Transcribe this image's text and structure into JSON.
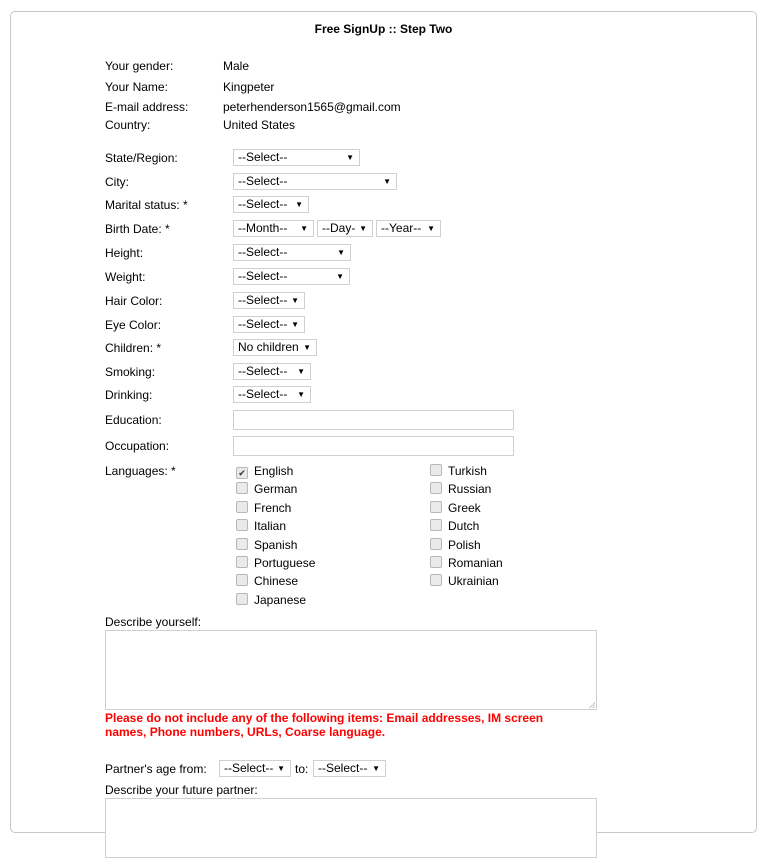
{
  "header": {
    "title": "Free SignUp :: Step Two"
  },
  "info": [
    {
      "label": "Your gender:",
      "value": "Male"
    },
    {
      "label": "Your Name:",
      "value": "Kingpeter"
    },
    {
      "label": "E-mail address:",
      "value": "peterhenderson1565@gmail.com"
    },
    {
      "label": "Country:",
      "value": "United States"
    }
  ],
  "fields": {
    "state": {
      "label": "State/Region:",
      "value": "--Select--"
    },
    "city": {
      "label": "City:",
      "value": "--Select--"
    },
    "marital": {
      "label": "Marital status: *",
      "value": "--Select--"
    },
    "birth": {
      "label": "Birth Date: *",
      "month": "--Month--",
      "day": "--Day-",
      "year": "--Year--"
    },
    "height": {
      "label": "Height:",
      "value": "--Select--"
    },
    "weight": {
      "label": "Weight:",
      "value": "--Select--"
    },
    "hair": {
      "label": "Hair Color:",
      "value": "--Select--"
    },
    "eye": {
      "label": "Eye Color:",
      "value": "--Select--"
    },
    "children": {
      "label": "Children: *",
      "value": "No children"
    },
    "smoking": {
      "label": "Smoking:",
      "value": "--Select--"
    },
    "drinking": {
      "label": "Drinking:",
      "value": "--Select--"
    },
    "education": {
      "label": "Education:",
      "value": ""
    },
    "occupation": {
      "label": "Occupation:",
      "value": ""
    }
  },
  "languages": {
    "label": "Languages: *",
    "left": [
      {
        "name": "English",
        "checked": true
      },
      {
        "name": "German",
        "checked": false
      },
      {
        "name": "French",
        "checked": false
      },
      {
        "name": "Italian",
        "checked": false
      },
      {
        "name": "Spanish",
        "checked": false
      },
      {
        "name": "Portuguese",
        "checked": false
      },
      {
        "name": "Chinese",
        "checked": false
      },
      {
        "name": "Japanese",
        "checked": false
      }
    ],
    "right": [
      {
        "name": "Turkish",
        "checked": false
      },
      {
        "name": "Russian",
        "checked": false
      },
      {
        "name": "Greek",
        "checked": false
      },
      {
        "name": "Dutch",
        "checked": false
      },
      {
        "name": "Polish",
        "checked": false
      },
      {
        "name": "Romanian",
        "checked": false
      },
      {
        "name": "Ukrainian",
        "checked": false
      }
    ]
  },
  "describe_yourself": {
    "label": "Describe yourself:",
    "value": ""
  },
  "warning": "Please do not include any of the following items: Email addresses, IM screen names, Phone numbers, URLs, Coarse language.",
  "partner_age": {
    "label_from": "Partner's age from:",
    "from": "--Select--",
    "label_to": "to:",
    "to": "--Select--"
  },
  "describe_partner": {
    "label": "Describe your future partner:",
    "value": ""
  },
  "icons": {
    "arrow": "▼",
    "check": "✔"
  },
  "colors": {
    "warning": "#ff0000",
    "border": "#d0d0d0"
  }
}
